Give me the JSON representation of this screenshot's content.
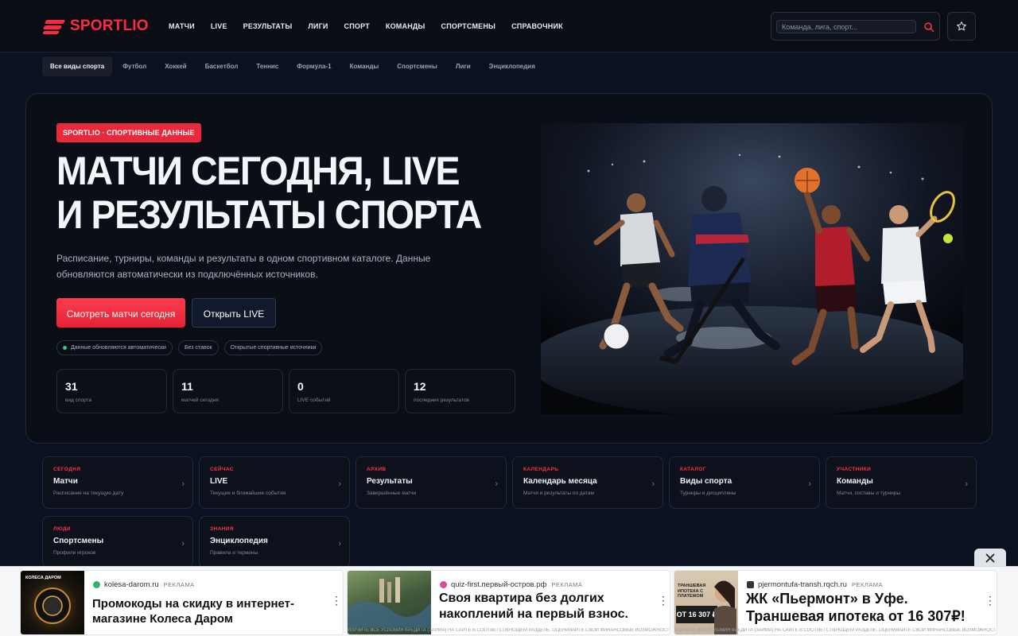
{
  "header": {
    "logo_text": "SPORTLIO",
    "nav": [
      "МАТЧИ",
      "LIVE",
      "РЕЗУЛЬТАТЫ",
      "ЛИГИ",
      "СПОРТ",
      "КОМАНДЫ",
      "СПОРТСМЕНЫ",
      "СПРАВОЧНИК"
    ],
    "search_placeholder": "Команда, лига, спорт..."
  },
  "subnav": {
    "items": [
      "Все виды спорта",
      "Футбол",
      "Хоккей",
      "Баскетбол",
      "Теннис",
      "Формула-1",
      "Команды",
      "Спортсмены",
      "Лиги",
      "Энциклопедия"
    ],
    "active_index": 0
  },
  "hero": {
    "badge": "SPORTLIO · СПОРТИВНЫЕ ДАННЫЕ",
    "title_line1": "МАТЧИ СЕГОДНЯ, LIVE",
    "title_line2": "И РЕЗУЛЬТАТЫ СПОРТА",
    "description": "Расписание, турниры, команды и результаты в одном спортивном каталоге. Данные обновляются автоматически из подключённых источников.",
    "primary_button": "Смотреть матчи сегодня",
    "secondary_button": "Открыть LIVE",
    "chips": [
      "Данные обновляются автоматически",
      "Без ставок",
      "Открытые спортивные источники"
    ],
    "stats": [
      {
        "value": "31",
        "label": "вид спорта"
      },
      {
        "value": "11",
        "label": "матчей сегодня"
      },
      {
        "value": "0",
        "label": "LIVE событий"
      },
      {
        "value": "12",
        "label": "последних результатов"
      }
    ]
  },
  "cards": [
    {
      "kicker": "СЕГОДНЯ",
      "title": "Матчи",
      "desc": "Расписание на текущую дату"
    },
    {
      "kicker": "СЕЙЧАС",
      "title": "LIVE",
      "desc": "Текущие и ближайшие события"
    },
    {
      "kicker": "АРХИВ",
      "title": "Результаты",
      "desc": "Завершённые матчи"
    },
    {
      "kicker": "КАЛЕНДАРЬ",
      "title": "Календарь месяца",
      "desc": "Матчи и результаты по датам"
    },
    {
      "kicker": "КАТАЛОГ",
      "title": "Виды спорта",
      "desc": "Турниры и дисциплины"
    },
    {
      "kicker": "УЧАСТНИКИ",
      "title": "Команды",
      "desc": "Матчи, составы и турниры"
    },
    {
      "kicker": "ЛЮДИ",
      "title": "Спортсмены",
      "desc": "Профили игроков"
    },
    {
      "kicker": "ЗНАНИЯ",
      "title": "Энциклопедия",
      "desc": "Правила и термины"
    }
  ],
  "ads": [
    {
      "source": "kolesa-darom.ru",
      "label": "РЕКЛАМА",
      "headline": "Промокоды на скидку в интернет-магазине Колеса Даром",
      "image_caption": "КОЛЕСА ДАРОМ"
    },
    {
      "source": "quiz-first.первый-остров.рф",
      "label": "РЕКЛАМА",
      "headline": "Своя квартира без долгих накоплений на первый взнос.",
      "disclaimer": "ИЗУЧИТЕ ВСЕ УСЛОВИЯ КРЕДИТА (ЗАЙМА) НА САЙТЕ В СООТВЕТСТВУЮЩЕМ РАЗДЕЛЕ. ОЦЕНИВАЙТЕ СВОИ ФИНАНСОВЫЕ ВОЗМОЖНОСТИ И РИСКИ"
    },
    {
      "source": "pjermontufa-transh.rqch.ru",
      "label": "РЕКЛАМА",
      "headline": "ЖК «Пьермонт» в Уфе. Траншевая ипотека от 16 307₽!",
      "image_caption_top": "ТРАНШЕВАЯ ИПОТЕКА С ПЛАТЕЖОМ",
      "image_price": "ОТ 16 307 ₽",
      "disclaimer": "ИЗУЧИТЕ ВСЕ УСЛОВИЯ КРЕДИТА (ЗАЙМА) НА САЙТЕ В СООТВЕТСТВУЮЩЕМ РАЗДЕЛЕ. ОЦЕНИВАЙТЕ СВОИ ФИНАНСОВЫЕ ВОЗМОЖНОСТИ И РИСКИ"
    }
  ],
  "colors": {
    "accent": "#ff2a3d",
    "background": "#0b1120",
    "live_dot": "#2fd07a"
  }
}
